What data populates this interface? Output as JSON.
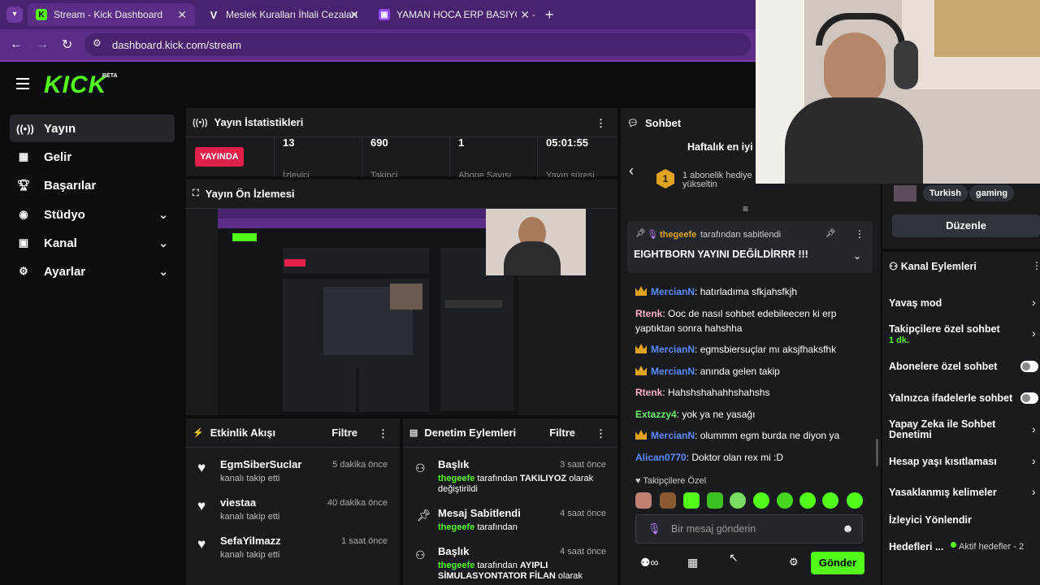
{
  "browser": {
    "tabs": [
      {
        "title": "Stream - Kick Dashboard"
      },
      {
        "title": "Meslek Kuralları İhlali Cezaları"
      },
      {
        "title": "YAMAN HOCA ERP BASIYOR - "
      }
    ],
    "url": "dashboard.kick.com/stream"
  },
  "app": {
    "logo": "KICK",
    "logo_badge": "BETA"
  },
  "sidebar": {
    "items": [
      {
        "label": "Yayın",
        "icon": "broadcast-icon"
      },
      {
        "label": "Gelir",
        "icon": "chart-icon"
      },
      {
        "label": "Başarılar",
        "icon": "trophy-icon"
      },
      {
        "label": "Stüdyo",
        "icon": "studio-icon"
      },
      {
        "label": "Kanal",
        "icon": "channel-icon"
      },
      {
        "label": "Ayarlar",
        "icon": "gear-icon"
      }
    ]
  },
  "stats": {
    "title": "Yayın İstatistikleri",
    "live_badge": "YAYINDA",
    "values": [
      {
        "value": "13",
        "label": "İzleyici"
      },
      {
        "value": "690",
        "label": "Takipçi"
      },
      {
        "value": "1",
        "label": "Abone Sayısı"
      },
      {
        "value": "05:01:55",
        "label": "Yayın süresi"
      }
    ]
  },
  "preview": {
    "title": "Yayın Ön İzlemesi"
  },
  "activity": {
    "title": "Etkinlik Akışı",
    "filter": "Filtre",
    "items": [
      {
        "name": "EgmSiberSuclar",
        "text": "kanalı takip etti",
        "time": "5 dakika önce"
      },
      {
        "name": "viestaa",
        "text": "kanalı takip etti",
        "time": "40 dakika önce"
      },
      {
        "name": "SefaYilmazz",
        "text": "kanalı takip etti",
        "time": "1 saat önce"
      }
    ]
  },
  "moderation": {
    "title": "Denetim Eylemleri",
    "filter": "Filtre",
    "items": [
      {
        "title": "Başlık",
        "user": "thegeefe",
        "text": "tarafından",
        "bold": "TAKILIYOZ",
        "rest": "olarak değiştirildi",
        "time": "3 saat önce"
      },
      {
        "title": "Mesaj Sabitlendi",
        "user": "thegeefe",
        "text": "tarafından",
        "bold": "",
        "rest": "",
        "time": "4 saat önce"
      },
      {
        "title": "Başlık",
        "user": "thegeefe",
        "text": "tarafından",
        "bold": "AYIPLI SİMULASYONTATOR FİLAN",
        "rest": "olarak",
        "time": "4 saat önce"
      }
    ]
  },
  "chat": {
    "title": "Sohbet",
    "weekly": "Haftalık en iyi",
    "gift_rank": "1",
    "gift_text": "1 abonelik hediye",
    "gift_text2": "yükseltin",
    "pinned_by_user": "thegeefe",
    "pinned_by_text": "tarafından sabitlendi",
    "pinned_message": "EIGHTBORN YAYINI DEĞİLDİRRR !!!",
    "messages": [
      {
        "user": "MercianN",
        "text": ": hatırladıma sfkjahsfkjh",
        "color": "#5b8cff",
        "crown": true
      },
      {
        "user": "Rtenk",
        "text": ": Ooc de nasıl sohbet edebileecen ki erp yaptıktan sonra hahshha",
        "color": "#ffb0c8",
        "crown": false
      },
      {
        "user": "MercianN",
        "text": ": egmsbiersuçlar mı aksjfhaksfhk",
        "color": "#5b8cff",
        "crown": true
      },
      {
        "user": "MercianN",
        "text": ": anında gelen takip",
        "color": "#5b8cff",
        "crown": true
      },
      {
        "user": "Rtenk",
        "text": ": Hahshshahahhshahshs",
        "color": "#ffb0c8",
        "crown": false
      },
      {
        "user": "Extazzy4",
        "text": ": yok ya ne yasağı",
        "color": "#6cf068",
        "crown": false
      },
      {
        "user": "MercianN",
        "text": ": olummm egm burda ne diyon ya",
        "color": "#5b8cff",
        "crown": true
      },
      {
        "user": "Alican0770",
        "text": ": Doktor olan rex mi :D",
        "color": "#5b8cff",
        "crown": false
      }
    ],
    "followers_only": "Takipçilere Özel",
    "input_placeholder": "Bir mesaj gönderin",
    "send": "Gönder"
  },
  "right": {
    "tags": [
      "Turkish",
      "gaming"
    ],
    "edit": "Düzenle",
    "actions_title": "Kanal Eylemleri",
    "actions": [
      {
        "label": "Yavaş mod",
        "sub": ""
      },
      {
        "label": "Takipçilere özel sohbet",
        "sub": "1 dk."
      },
      {
        "label": "Abonelere özel sohbet",
        "sub": ""
      },
      {
        "label": "Yalnızca ifadelerle sohbet",
        "sub": ""
      },
      {
        "label": "Yapay Zeka ile Sohbet Denetimi",
        "sub": ""
      },
      {
        "label": "Hesap yaşı kısıtlaması",
        "sub": ""
      },
      {
        "label": "Yasaklanmış kelimeler",
        "sub": ""
      },
      {
        "label": "İzleyici Yönlendir",
        "sub": ""
      },
      {
        "label": "Hedefleri ...",
        "sub": "Aktif hedefler - 2"
      }
    ]
  },
  "colors": {
    "kick_green": "#53fc18",
    "live_red": "#e2204a",
    "browser_purple": "#5b2d86"
  }
}
